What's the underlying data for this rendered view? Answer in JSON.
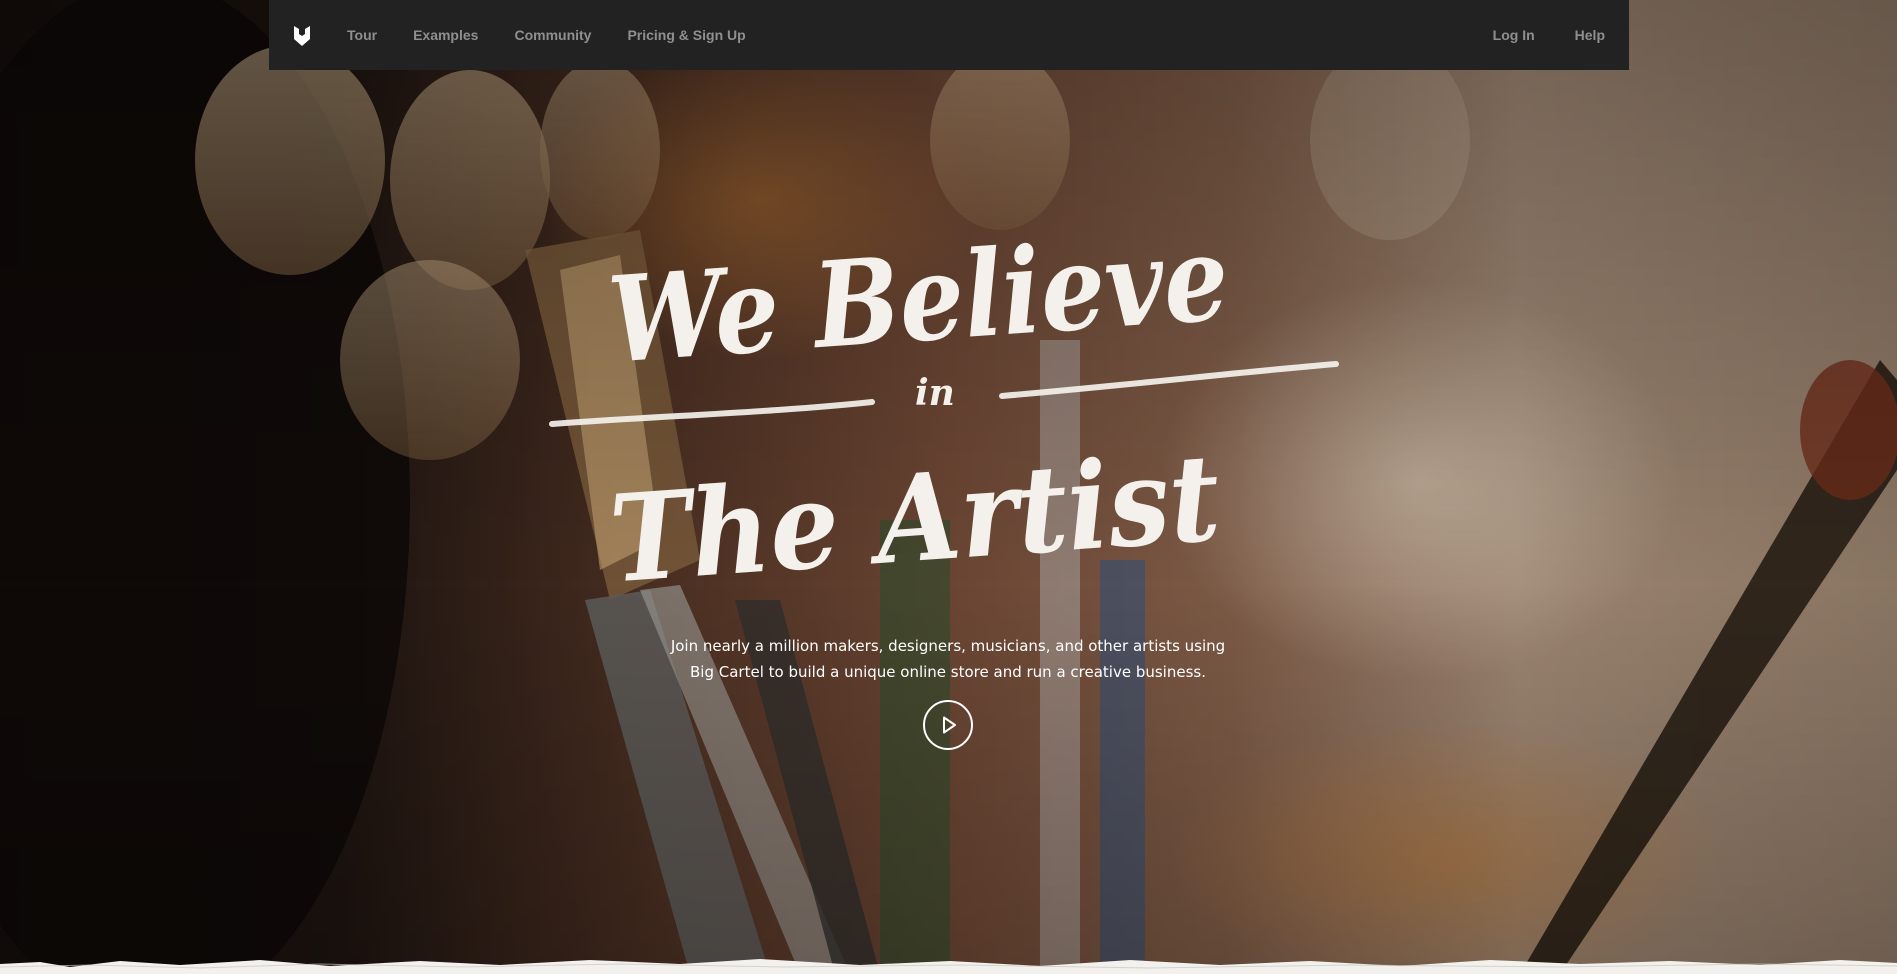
{
  "nav": {
    "logo_icon": "big-cartel-logo-icon",
    "links_left": [
      {
        "label": "Tour"
      },
      {
        "label": "Examples"
      },
      {
        "label": "Community"
      },
      {
        "label": "Pricing & Sign Up"
      }
    ],
    "links_right": [
      {
        "label": "Log In"
      },
      {
        "label": "Help"
      }
    ]
  },
  "hero": {
    "headline": {
      "line1": "We Believe",
      "connector": "in",
      "line2": "The Artist"
    },
    "tagline_line1": "Join nearly a million makers, designers, musicians, and other artists using",
    "tagline_line2": "Big Cartel to build a unique online store and run a creative business.",
    "play_icon": "play-icon",
    "background_icon": "paintbrushes-photo"
  },
  "colors": {
    "navbar": "#222222",
    "nav_text": "#8f8f8f",
    "headline_text": "#f4f1ec",
    "body_text": "#ffffff"
  }
}
